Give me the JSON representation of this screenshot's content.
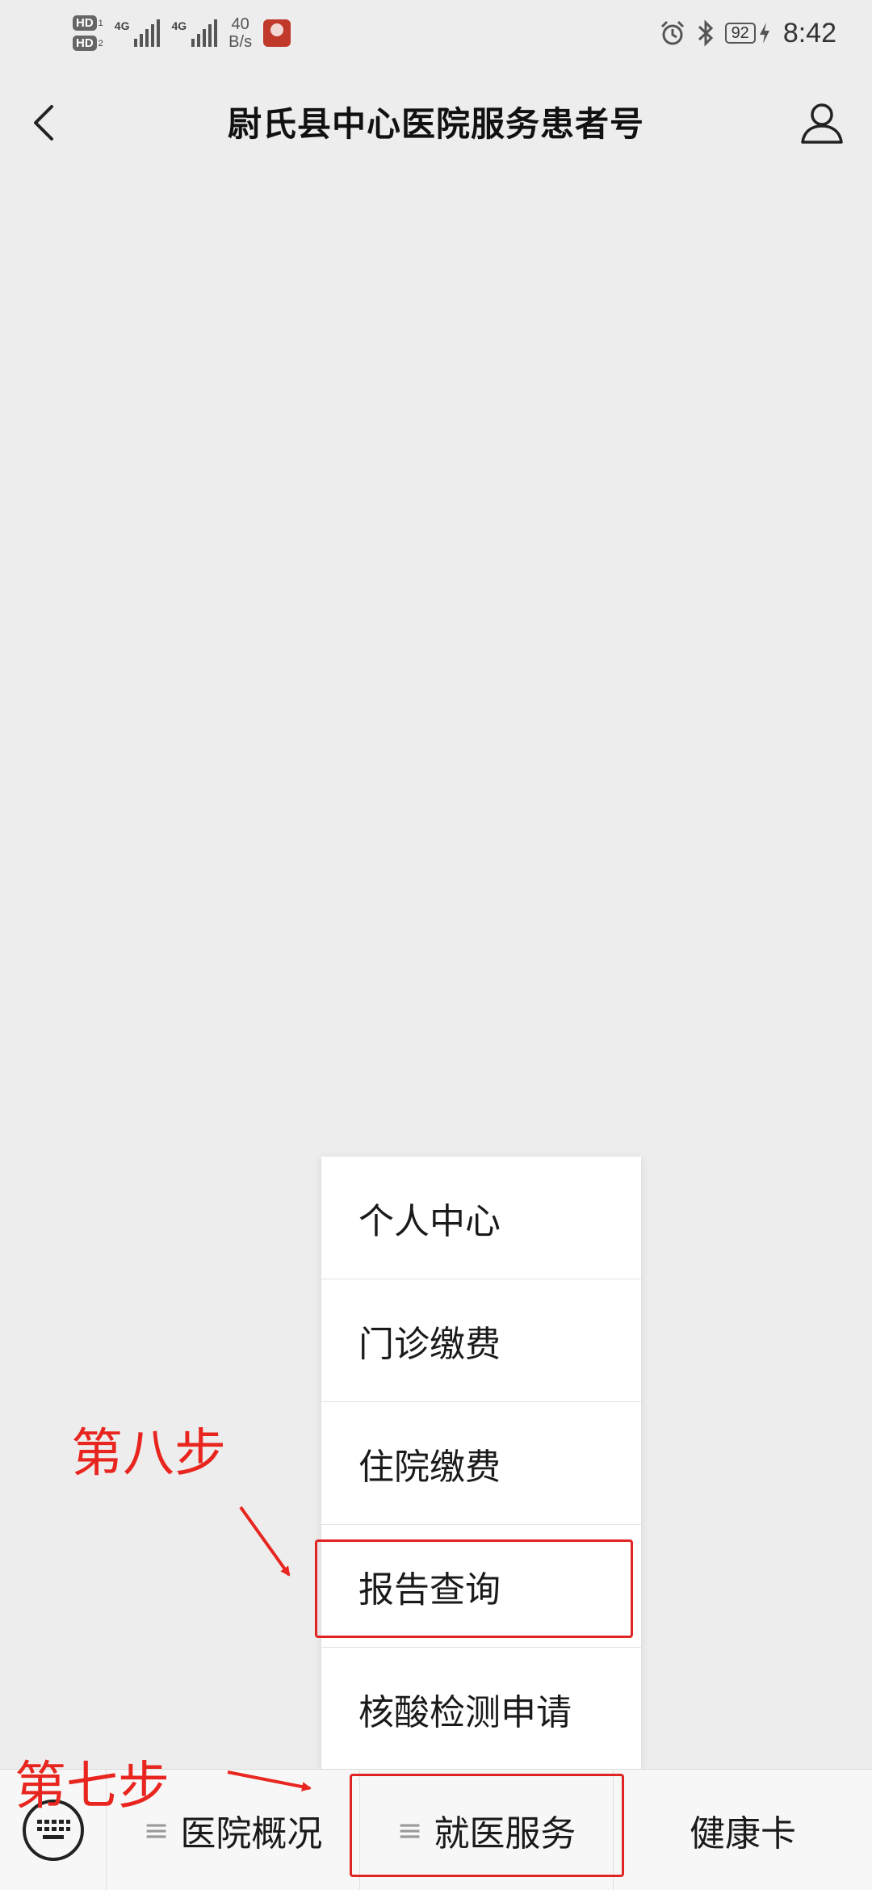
{
  "status_bar": {
    "hd1": "HD",
    "hd1_sub": "1",
    "hd2": "HD",
    "hd2_sub": "2",
    "net1": "4G",
    "net2": "4G",
    "speed_value": "40",
    "speed_unit": "B/s",
    "battery": "92",
    "time": "8:42",
    "icons": [
      "alarm-icon",
      "bluetooth-icon",
      "charging-icon"
    ]
  },
  "nav": {
    "title": "尉氏县中心医院服务患者号"
  },
  "popup_menu": {
    "items": [
      "个人中心",
      "门诊缴费",
      "住院缴费",
      "报告查询",
      "核酸检测申请"
    ]
  },
  "menu_bar": {
    "tabs": [
      {
        "label": "医院概况",
        "has_submenu": true
      },
      {
        "label": "就医服务",
        "has_submenu": true
      },
      {
        "label": "健康卡",
        "has_submenu": false
      }
    ],
    "submenu_glyph": "≡"
  },
  "annotations": {
    "step8": "第八步",
    "step7": "第七步",
    "color": "#e8261f"
  }
}
